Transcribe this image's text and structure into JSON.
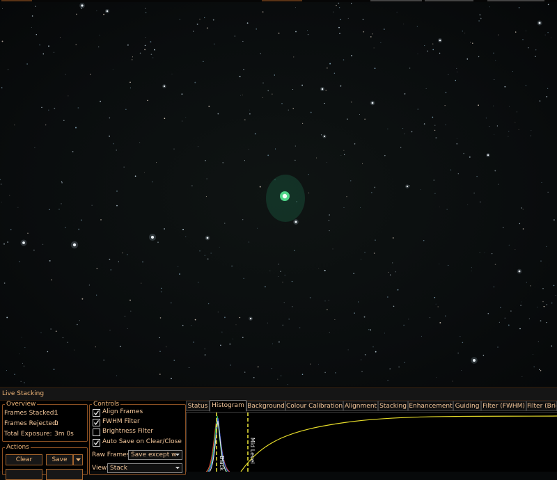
{
  "panel": {
    "title": "Live Stacking"
  },
  "overview": {
    "legend": "Overview",
    "rows": [
      {
        "label": "Frames Stacked:",
        "value": "1"
      },
      {
        "label": "Frames Rejected:",
        "value": "0"
      },
      {
        "label": "Total Exposure:",
        "value": "3m 0s"
      }
    ]
  },
  "actions": {
    "legend": "Actions",
    "clear_label": "Clear",
    "save_label": "Save"
  },
  "controls": {
    "legend": "Controls",
    "checkboxes": [
      {
        "label": "Align Frames",
        "checked": true
      },
      {
        "label": "FWHM Filter",
        "checked": true
      },
      {
        "label": "Brightness Filter",
        "checked": false
      },
      {
        "label": "Auto Save on Clear/Close",
        "checked": true
      }
    ],
    "raw_frames_label": "Raw Frames",
    "raw_frames_value": "Save except w",
    "view_label": "View",
    "view_value": "Stack"
  },
  "tabs": [
    {
      "label": "Status",
      "active": false
    },
    {
      "label": "Histogram",
      "active": true
    },
    {
      "label": "Background",
      "active": false
    },
    {
      "label": "Colour Calibration",
      "active": false
    },
    {
      "label": "Alignment",
      "active": false
    },
    {
      "label": "Stacking",
      "active": false
    },
    {
      "label": "Enhancement",
      "active": false
    },
    {
      "label": "Guiding",
      "active": false
    },
    {
      "label": "Filter (FWHM)",
      "active": false
    },
    {
      "label": "Filter (Brig",
      "active": false
    }
  ],
  "histogram": {
    "black_label": "Black",
    "mid_label": "Mid Level",
    "colors": {
      "red": "#e0413a",
      "green": "#2fc24a",
      "blue": "#3f6fe8",
      "luminance": "#e8e8e8",
      "curve": "#e6dc2a",
      "marker": "#f2ec3a"
    }
  },
  "theme": {
    "accent": "#a4642c",
    "text": "#f0b679"
  }
}
